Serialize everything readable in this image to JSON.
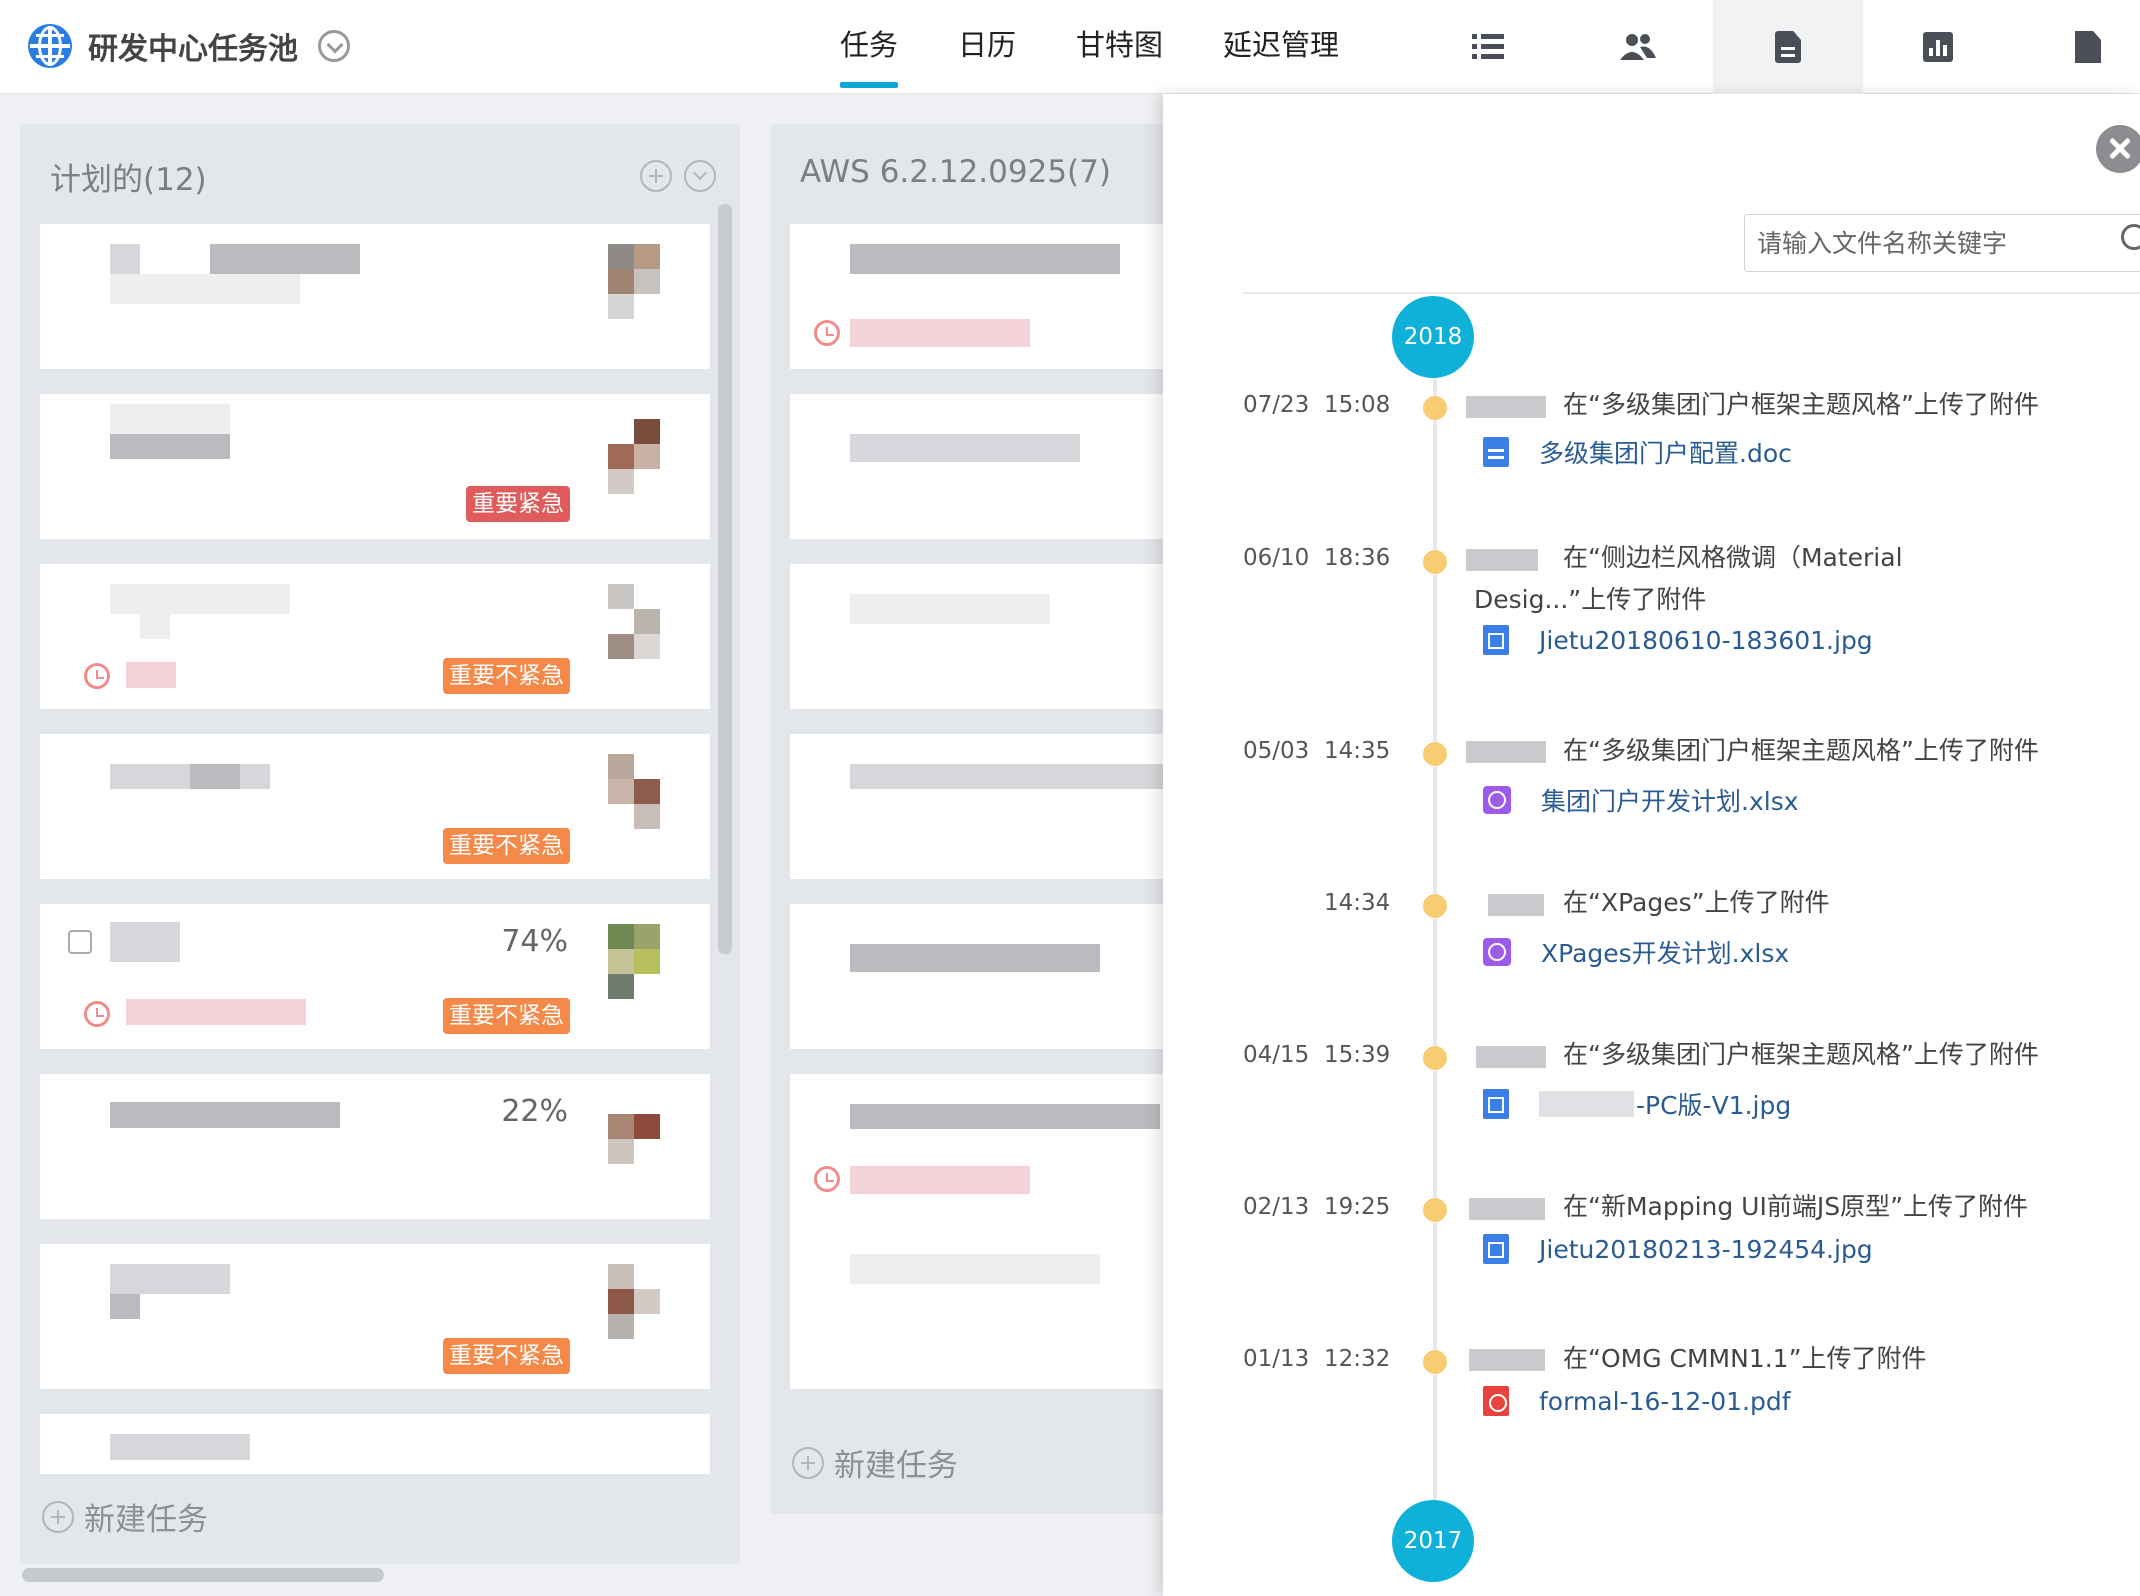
{
  "header": {
    "app_name": "研发中心任务池",
    "tabs": [
      {
        "label": "任务",
        "active": true
      },
      {
        "label": "日历",
        "active": false
      },
      {
        "label": "甘特图",
        "active": false
      },
      {
        "label": "延迟管理",
        "active": false
      }
    ],
    "tools": [
      "list-icon",
      "users-icon",
      "document-icon",
      "report-icon",
      "edit-document-icon"
    ],
    "active_tool": "document-icon"
  },
  "board": {
    "columns": [
      {
        "title": "计划的(12)",
        "cards": [
          {
            "tag": "",
            "percent": ""
          },
          {
            "tag": "重要紧急",
            "tag_color": "#e05c5c",
            "percent": ""
          },
          {
            "tag": "重要不紧急",
            "tag_color": "#f4894a",
            "percent": ""
          },
          {
            "tag": "重要不紧急",
            "tag_color": "#f4894a",
            "percent": ""
          },
          {
            "tag": "重要不紧急",
            "tag_color": "#f4894a",
            "percent": "74%"
          },
          {
            "tag": "",
            "percent": "22%"
          },
          {
            "tag": "重要不紧急",
            "tag_color": "#f4894a",
            "percent": ""
          }
        ],
        "new_task_label": "新建任务"
      },
      {
        "title": "AWS 6.2.12.0925(7)",
        "new_task_label": "新建任务"
      }
    ]
  },
  "panel": {
    "search_placeholder": "请输入文件名称关键字",
    "years": [
      "2018",
      "2017"
    ],
    "events": [
      {
        "date": "07/23",
        "time": "15:08",
        "text": "在“多级集团门户框架主题风格”上传了附件",
        "file": "多级集团门户配置.doc",
        "file_icon": "doc"
      },
      {
        "date": "06/10",
        "time": "18:36",
        "text": "在“侧边栏风格微调（Material Desig...”上传了附件",
        "file": "Jietu20180610-183601.jpg",
        "file_icon": "img"
      },
      {
        "date": "05/03",
        "time": "14:35",
        "text": "在“多级集团门户框架主题风格”上传了附件",
        "file": "集团门户开发计划.xlsx",
        "file_icon": "xls"
      },
      {
        "date": "",
        "time": "14:34",
        "text": "在“XPages”上传了附件",
        "file": "XPages开发计划.xlsx",
        "file_icon": "xls"
      },
      {
        "date": "04/15",
        "time": "15:39",
        "text": "在“多级集团门户框架主题风格”上传了附件",
        "file": "-PC版-V1.jpg",
        "file_icon": "img"
      },
      {
        "date": "02/13",
        "time": "19:25",
        "text": "在“新Mapping UI前端JS原型”上传了附件",
        "file": "Jietu20180213-192454.jpg",
        "file_icon": "img"
      },
      {
        "date": "01/13",
        "time": "12:32",
        "text": "在“OMG CMMN1.1”上传了附件",
        "file": "formal-16-12-01.pdf",
        "file_icon": "pdf"
      }
    ]
  }
}
